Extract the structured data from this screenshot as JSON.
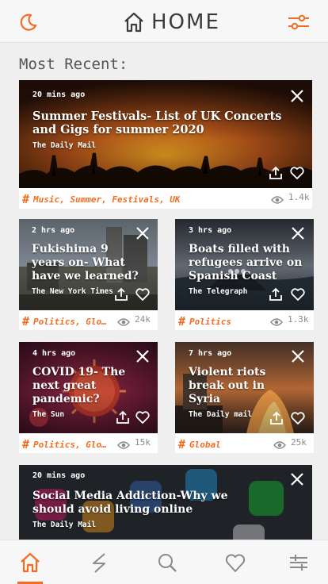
{
  "header": {
    "title": "HOME",
    "left_icon": "moon-icon",
    "right_icon": "sliders-icon"
  },
  "section_title": "Most Recent:",
  "colors": {
    "accent": "#f26d21",
    "text": "#3b3b3b",
    "muted": "#8a8a8a"
  },
  "cards": [
    {
      "time": "20 mins ago",
      "headline": "Summer Festivals- List of UK Concerts and Gigs for summer 2020",
      "source": "The Daily Mail",
      "tags": "Music, Summer, Festivals, UK",
      "views": "1.4k"
    },
    {
      "time": "2 hrs ago",
      "headline": "Fukishima 9 years on- What have we learned?",
      "source": "The New York Times",
      "tags": "Politics, Global…",
      "views": "24k"
    },
    {
      "time": "3 hrs ago",
      "headline": "Boats filled with refugees arrive on Spanish Coast",
      "source": "The Telegraph",
      "tags": "Politics",
      "views": "1.3k"
    },
    {
      "time": "4 hrs ago",
      "headline": "COVID 19- The next great pandemic?",
      "source": "The Sun",
      "tags": "Politics, Global…",
      "views": "15k"
    },
    {
      "time": "7 hrs ago",
      "headline": "Violent riots break out in Syria",
      "source": "The Daily mail",
      "tags": "Global",
      "views": "25k"
    },
    {
      "time": "20 mins ago",
      "headline": "Social Media Addiction-Why we should avoid living online",
      "source": "The Daily Mail"
    }
  ],
  "bottom_nav": [
    "home-icon",
    "lightning-icon",
    "search-icon",
    "heart-icon",
    "menu-icon"
  ]
}
